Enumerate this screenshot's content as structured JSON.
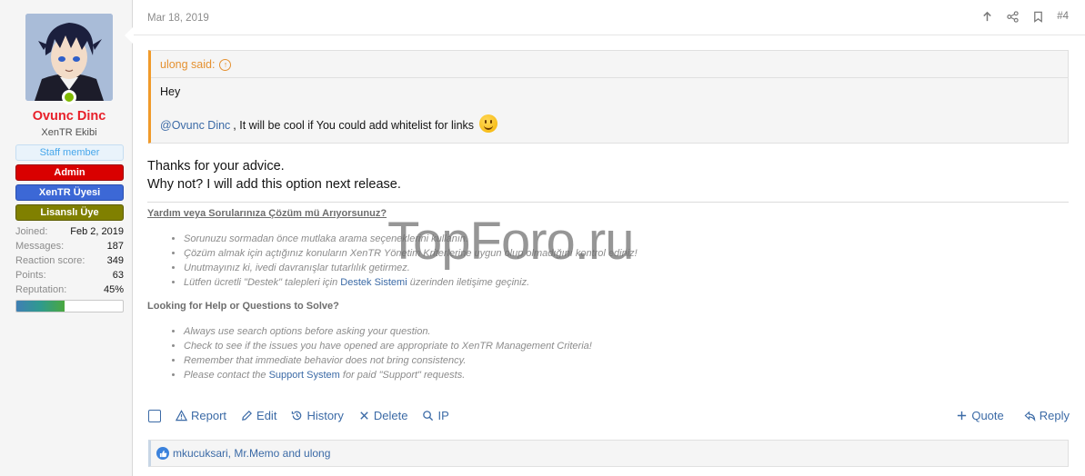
{
  "user": {
    "name": "Ovunc Dinc",
    "title": "XenTR Ekibi",
    "banners": {
      "staff": "Staff member",
      "admin": "Admin",
      "member": "XenTR Üyesi",
      "license": "Lisanslı Üye"
    },
    "stats": [
      {
        "label": "Joined:",
        "value": "Feb 2, 2019"
      },
      {
        "label": "Messages:",
        "value": "187"
      },
      {
        "label": "Reaction score:",
        "value": "349"
      },
      {
        "label": "Points:",
        "value": "63"
      },
      {
        "label": "Reputation:",
        "value": "45%"
      }
    ],
    "reputation_fraction": 0.45,
    "online": true
  },
  "message": {
    "date": "Mar 18, 2019",
    "post_number": "#4",
    "quote": {
      "author_said": "ulong said:",
      "line1": "Hey",
      "mention": "@Ovunc Dinc",
      "line2_rest": ", It will be cool if You could add whitelist for links"
    },
    "body_line1": "Thanks for your advice.",
    "body_line2": "Why not? I will add this option next release."
  },
  "signature": {
    "tr_heading": "Yardım veya Sorularınıza Çözüm mü Arıyorsunuz?",
    "tr_items": [
      "Sorunuzu sormadan önce mutlaka arama seçeneklerini kullanın.",
      "Çözüm almak için açtığınız konuların XenTR Yönetim Kriterlerine uygun olup olmadığını kontrol ediniz!",
      "Unutmayınız ki, ivedi davranışlar tutarlılık getirmez."
    ],
    "tr_item4_pre": "Lütfen ücretli \"Destek\" talepleri için ",
    "tr_item4_link": "Destek Sistemi",
    "tr_item4_post": " üzerinden iletişime geçiniz.",
    "en_heading": "Looking for Help or Questions to Solve?",
    "en_items": [
      "Always use search options before asking your question.",
      "Check to see if the issues you have opened are appropriate to XenTR Management Criteria!",
      "Remember that immediate behavior does not bring consistency."
    ],
    "en_item4_pre": "Please contact the ",
    "en_item4_link": "Support System",
    "en_item4_post": " for paid \"Support\" requests."
  },
  "watermark": "TopForo.ru",
  "actions": {
    "report": "Report",
    "edit": "Edit",
    "history": "History",
    "delete": "Delete",
    "ip": "IP",
    "quote": "Quote",
    "reply": "Reply"
  },
  "reactions": {
    "text": "mkucuksari, Mr.Memo and ulong"
  },
  "colors": {
    "username": "#e8202a",
    "link": "#3b6aa6",
    "quote_accent": "#f09a2a",
    "admin_banner": "#d90000",
    "member_banner": "#3c68d6",
    "license_banner": "#808000",
    "online": "#7fb900"
  },
  "icons": {
    "share": "share-icon",
    "bookmark": "bookmark-icon",
    "up": "arrow-up-icon",
    "report": "warning-icon",
    "edit": "pencil-icon",
    "history": "history-icon",
    "delete": "close-icon",
    "ip": "search-icon",
    "quote": "plus-icon",
    "reply": "reply-icon",
    "like": "thumbs-up-icon"
  }
}
